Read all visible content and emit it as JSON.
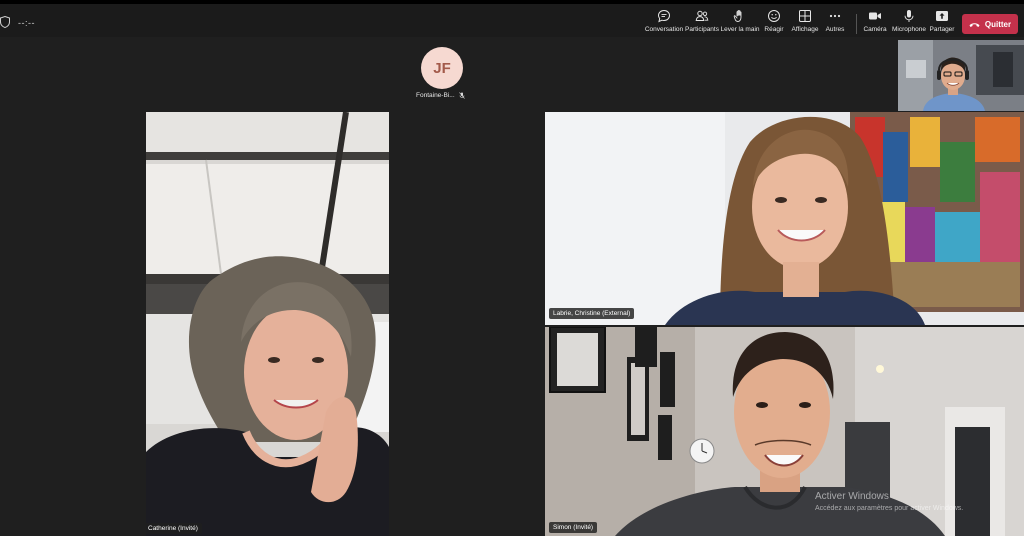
{
  "toolbar": {
    "timer": "--:--",
    "buttons": [
      {
        "label": "Conversation",
        "icon": "chat-icon"
      },
      {
        "label": "Participants",
        "icon": "people-icon"
      },
      {
        "label": "Lever la main",
        "icon": "raise-hand-icon"
      },
      {
        "label": "Réagir",
        "icon": "react-icon"
      },
      {
        "label": "Affichage",
        "icon": "layout-grid-icon"
      },
      {
        "label": "Autres",
        "icon": "more-icon"
      },
      {
        "label": "Caméra",
        "icon": "camera-icon"
      },
      {
        "label": "Microphone",
        "icon": "microphone-icon"
      },
      {
        "label": "Partager",
        "icon": "share-icon"
      }
    ],
    "quit_label": "Quitter",
    "quit_color": "#c4314b"
  },
  "audio_participant": {
    "initials": "JF",
    "name": "Fontaine-Bi..."
  },
  "tiles": {
    "catherine": "Catherine (Invité)",
    "christine": "Labrie, Christine (External)",
    "simon": "Simon (Invité)"
  },
  "watermark": {
    "title": "Activer Windows",
    "subtitle": "Accédez aux paramètres pour activer Windows."
  }
}
